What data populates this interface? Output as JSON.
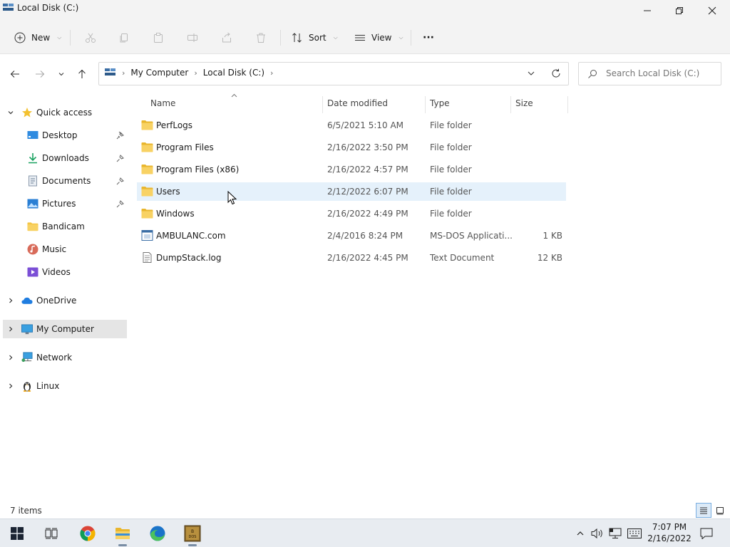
{
  "window": {
    "title": "Local Disk (C:)"
  },
  "toolbar": {
    "new_label": "New",
    "sort_label": "Sort",
    "view_label": "View",
    "more_label": "···"
  },
  "address": {
    "crumbs": [
      "My Computer",
      "Local Disk (C:)"
    ]
  },
  "search": {
    "placeholder": "Search Local Disk (C:)"
  },
  "sidebar": {
    "quick_access": "Quick access",
    "items": [
      {
        "label": "Desktop",
        "icon": "desktop-icon"
      },
      {
        "label": "Downloads",
        "icon": "download-icon"
      },
      {
        "label": "Documents",
        "icon": "document-icon"
      },
      {
        "label": "Pictures",
        "icon": "pictures-icon"
      },
      {
        "label": "Bandicam",
        "icon": "folder-icon"
      },
      {
        "label": "Music",
        "icon": "music-icon"
      },
      {
        "label": "Videos",
        "icon": "videos-icon"
      }
    ],
    "onedrive": "OneDrive",
    "my_computer": "My Computer",
    "network": "Network",
    "linux": "Linux"
  },
  "columns": {
    "name": "Name",
    "date": "Date modified",
    "type": "Type",
    "size": "Size"
  },
  "files": [
    {
      "name": "PerfLogs",
      "date": "6/5/2021 5:10 AM",
      "type": "File folder",
      "size": "",
      "icon": "folder-icon"
    },
    {
      "name": "Program Files",
      "date": "2/16/2022 3:50 PM",
      "type": "File folder",
      "size": "",
      "icon": "folder-icon"
    },
    {
      "name": "Program Files (x86)",
      "date": "2/16/2022 4:57 PM",
      "type": "File folder",
      "size": "",
      "icon": "folder-icon"
    },
    {
      "name": "Users",
      "date": "2/12/2022 6:07 PM",
      "type": "File folder",
      "size": "",
      "icon": "folder-icon"
    },
    {
      "name": "Windows",
      "date": "2/16/2022 4:49 PM",
      "type": "File folder",
      "size": "",
      "icon": "folder-icon"
    },
    {
      "name": "AMBULANC.com",
      "date": "2/4/2016 8:24 PM",
      "type": "MS-DOS Applicati...",
      "size": "1 KB",
      "icon": "application-icon"
    },
    {
      "name": "DumpStack.log",
      "date": "2/16/2022 4:45 PM",
      "type": "Text Document",
      "size": "12 KB",
      "icon": "text-file-icon"
    }
  ],
  "status": {
    "count": "7 items"
  },
  "clock": {
    "time": "7:07 PM",
    "date": "2/16/2022"
  },
  "colors": {
    "folder": "#f4c542",
    "accent": "#0067c0",
    "hover": "#e5f1fb"
  }
}
